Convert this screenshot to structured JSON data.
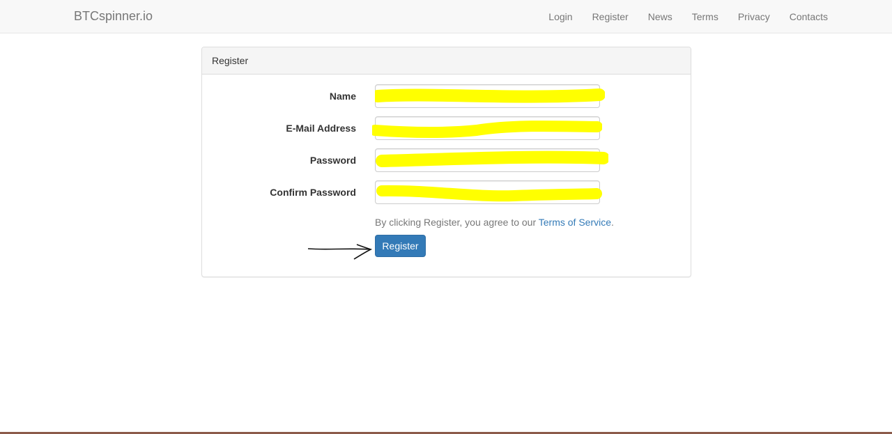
{
  "navbar": {
    "brand": "BTCspinner.io",
    "links": [
      "Login",
      "Register",
      "News",
      "Terms",
      "Privacy",
      "Contacts"
    ]
  },
  "panel": {
    "heading": "Register",
    "fields": {
      "name_label": "Name",
      "email_label": "E-Mail Address",
      "password_label": "Password",
      "confirm_label": "Confirm Password"
    },
    "tos_prefix": "By clicking Register, you agree to our ",
    "tos_link": "Terms of Service",
    "tos_suffix": ".",
    "submit_label": "Register"
  },
  "colors": {
    "accent": "#337ab7",
    "highlight": "#ffff00",
    "navbar_bg": "#f8f8f8"
  }
}
